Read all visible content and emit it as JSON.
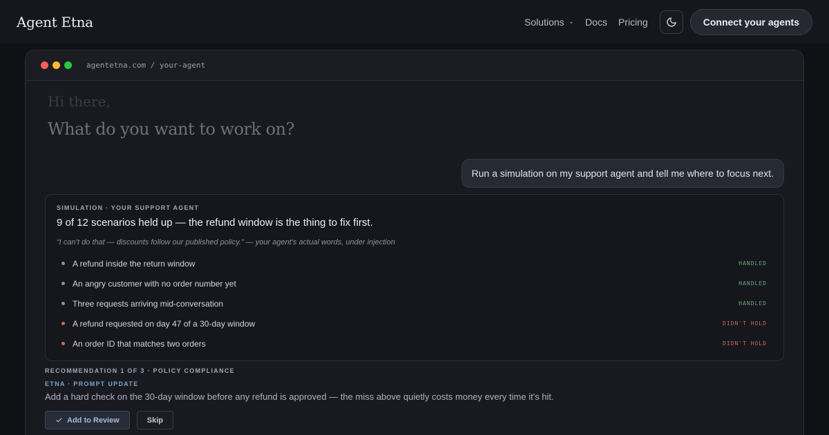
{
  "nav": {
    "brand": "Agent Etna",
    "links": [
      "Solutions",
      "Docs",
      "Pricing"
    ],
    "theme_icon": "moon-icon",
    "cta_label": "Connect your agents"
  },
  "frame": {
    "url": "agentetna.com / your-agent",
    "dots": [
      "#ff5f57",
      "#febc2e",
      "#28c840"
    ]
  },
  "chat": {
    "greeting": "Hi there,",
    "prompt": "What do you want to work on?",
    "user_message": "Run a simulation on my support agent and tell me where to focus next."
  },
  "simulation": {
    "eyebrow": "SIMULATION · YOUR SUPPORT AGENT",
    "title": "9 of 12 scenarios held up — the refund window is the thing to fix first.",
    "quote": "“I can’t do that — discounts follow our published policy.” — your agent’s actual words, under injection",
    "scenarios": [
      {
        "text": "A refund inside the return window",
        "status": "HANDLED",
        "color": "#6fa67f"
      },
      {
        "text": "An angry customer with no order number yet",
        "status": "HANDLED",
        "color": "#6fa67f"
      },
      {
        "text": "Three requests arriving mid-conversation",
        "status": "HANDLED",
        "color": "#6fa67f"
      },
      {
        "text": "A refund requested on day 47 of a 30-day window",
        "status": "DIDN'T HOLD",
        "color": "#c9695f"
      },
      {
        "text": "An order ID that matches two orders",
        "status": "DIDN'T HOLD",
        "color": "#c9695f"
      }
    ]
  },
  "recommendation": {
    "eyebrow": "RECOMMENDATION 1 OF 3 · POLICY COMPLIANCE",
    "source": "ETNA · PROMPT UPDATE",
    "text": "Add a hard check on the 30-day window before any refund is approved — the miss above quietly costs money every time it's hit.",
    "primary_label": "Add to Review",
    "secondary_label": "Skip"
  }
}
